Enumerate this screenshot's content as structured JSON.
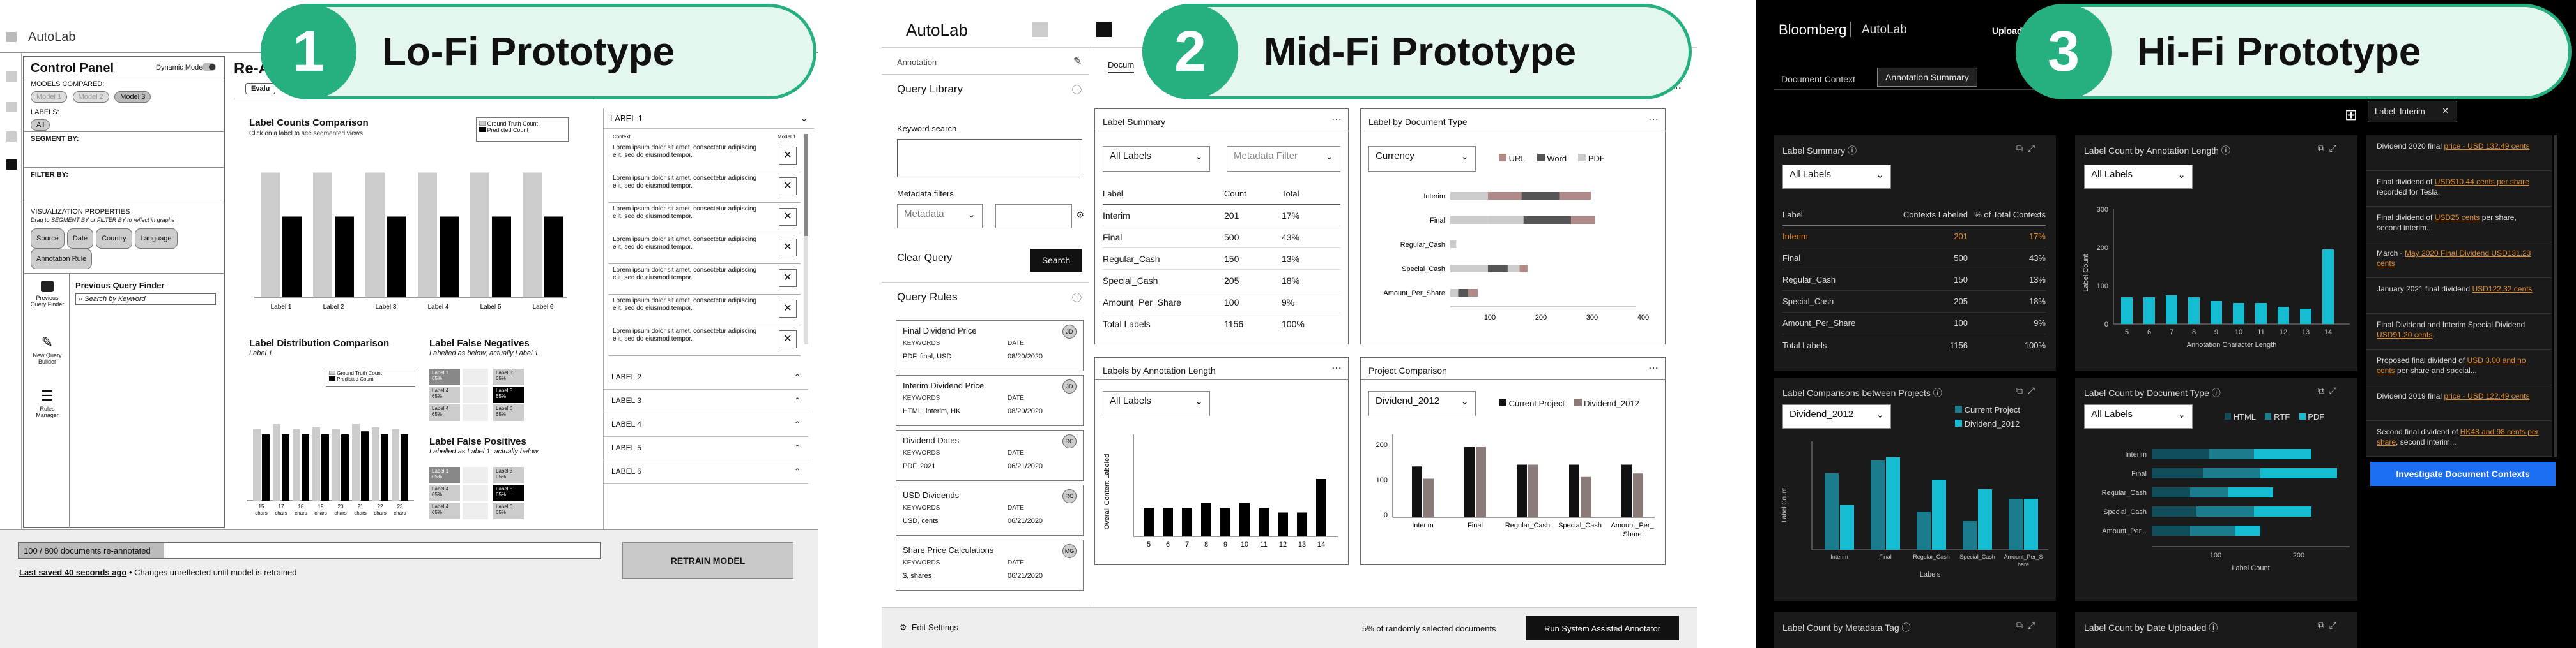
{
  "badges": [
    {
      "num": "1",
      "title": "Lo-Fi Prototype"
    },
    {
      "num": "2",
      "title": "Mid-Fi Prototype"
    },
    {
      "num": "3",
      "title": "Hi-Fi Prototype"
    }
  ],
  "lofi": {
    "app_title": "AutoLab",
    "control_panel": "Control Panel",
    "dynamic_mode": "Dynamic Mode",
    "models_compared": "MODELS COMPARED:",
    "model_chips": [
      "Model 1",
      "Model 2",
      "Model 3"
    ],
    "labels": "LABELS:",
    "all_chip": "All",
    "segment_by": "SEGMENT BY:",
    "filter_by": "FILTER BY:",
    "vis_props": "VISUALIZATION PROPERTIES",
    "vis_hint": "Drag to SEGMENT BY or FILTER BY to reflect in graphs",
    "vis_chips": [
      "Source",
      "Date",
      "Country",
      "Language",
      "Annotation Rule"
    ],
    "prev_query_finder": "Previous Query Finder",
    "search_placeholder": "Search by Keyword",
    "nav_prev": "Previous Query Finder",
    "nav_new": "New Query Builder",
    "nav_rules": "Rules Manager",
    "heading_partial": "Re-A",
    "tab_partial": "Evalu",
    "label_counts_title": "Label Counts Comparison",
    "label_counts_sub": "Click on a label to see segmented views",
    "legend_gt": "Ground Truth Count",
    "legend_pred": "Predicted Count",
    "label_counts_x": [
      "Label 1",
      "Label 2",
      "Label 3",
      "Label 4",
      "Label 5",
      "Label 6"
    ],
    "label_counts_gt": [
      0.85,
      0.85,
      0.85,
      0.85,
      0.85,
      0.85
    ],
    "label_counts_pred": [
      0.55,
      0.55,
      0.55,
      0.55,
      0.55,
      0.55
    ],
    "label_dist_title": "Label Distribution Comparison",
    "label_dist_sub": "Label 1",
    "label_dist_x": [
      "15 chars",
      "17 chars",
      "18 chars",
      "19 chars",
      "20 chars",
      "21 chars",
      "22 chars",
      "23 chars"
    ],
    "false_neg_title": "Label False Negatives",
    "false_neg_sub": "Labelled as below; actually Label 1",
    "false_pos_title": "Label False Positives",
    "false_pos_sub": "Labelled as Label 1; actually below",
    "fn_cells": [
      {
        "l": "Label 1",
        "p": "65%"
      },
      {
        "l": "Label 3",
        "p": "65%"
      },
      {
        "l": "Label 4",
        "p": "65%"
      },
      {
        "l": "Label 5",
        "p": "65%"
      },
      {
        "l": "Label 4",
        "p": "65%"
      },
      {
        "l": "Label 6",
        "p": "65%"
      }
    ],
    "fp_cells": [
      {
        "l": "Label 1",
        "p": "65%"
      },
      {
        "l": "Label 3",
        "p": "65%"
      },
      {
        "l": "Label 4",
        "p": "65%"
      },
      {
        "l": "Label 5",
        "p": "65%"
      },
      {
        "l": "Label 4",
        "p": "65%"
      },
      {
        "l": "Label 6",
        "p": "65%"
      }
    ],
    "acc_open": "LABEL 1",
    "col_context": "Context",
    "col_model": "Model 1",
    "lorem": "Lorem ipsum dolor sit amet, consectetur adipiscing elit, sed do eiusmod tempor.",
    "acc_rows": [
      "LABEL 2",
      "LABEL 3",
      "LABEL 4",
      "LABEL 5",
      "LABEL 6"
    ],
    "progress": "100 / 800 documents re-annotated",
    "last_saved": "Last saved 40 seconds ago",
    "changes_note": "• Changes unreflected until model is retrained",
    "retrain": "RETRAIN MODEL"
  },
  "midfi": {
    "app_title": "AutoLab",
    "annotation": "Annotation",
    "tab_partial": "Docum",
    "query_library": "Query Library",
    "keyword_search": "Keyword search",
    "metadata_filters": "Metadata filters",
    "metadata_select": "Metadata",
    "clear_query": "Clear Query",
    "search": "Search",
    "query_rules": "Query Rules",
    "kw": "KEYWORDS",
    "date": "DATE",
    "rules": [
      {
        "name": "Final Dividend Price",
        "kw": "PDF, final, USD",
        "date": "08/20/2020",
        "av": "JD"
      },
      {
        "name": "Interim Dividend Price",
        "kw": "HTML, interim, HK",
        "date": "08/20/2020",
        "av": "JD"
      },
      {
        "name": "Dividend Dates",
        "kw": "PDF, 2021",
        "date": "06/21/2020",
        "av": "RC"
      },
      {
        "name": "USD Dividends",
        "kw": "USD, cents",
        "date": "06/21/2020",
        "av": "RC"
      },
      {
        "name": "Share Price Calculations",
        "kw": "$, shares",
        "date": "06/21/2020",
        "av": "MG"
      }
    ],
    "edit_settings": "Edit Settings",
    "pct_note": "5% of randomly selected documents",
    "run_btn": "Run System Assisted Annotator",
    "label_summary": {
      "title": "Label Summary",
      "filter": "All Labels",
      "meta": "Metadata Filter",
      "cols": [
        "Label",
        "Count",
        "Total"
      ],
      "rows": [
        [
          "Interim",
          "201",
          "17%"
        ],
        [
          "Final",
          "500",
          "43%"
        ],
        [
          "Regular_Cash",
          "150",
          "13%"
        ],
        [
          "Special_Cash",
          "205",
          "18%"
        ],
        [
          "Amount_Per_Share",
          "100",
          "9%"
        ]
      ],
      "total": [
        "Total Labels",
        "1156",
        "100%"
      ]
    },
    "by_doc_type": {
      "title": "Label by Document Type",
      "filter": "Currency",
      "legend": [
        "URL",
        "Word",
        "PDF"
      ],
      "cats": [
        "Interim",
        "Final",
        "Regular_Cash",
        "Special_Cash",
        "Amount_Per_Share"
      ],
      "ticks": [
        "100",
        "200",
        "300",
        "400"
      ],
      "segs": [
        [
          95,
          0,
          165,
          0,
          250,
          10
        ],
        [
          95,
          0,
          100,
          0,
          265,
          5
        ],
        [
          15,
          0,
          0,
          0,
          0,
          0
        ],
        [
          120,
          60,
          0,
          0,
          0,
          0
        ],
        [
          0,
          0,
          70,
          0,
          0,
          0
        ]
      ]
    },
    "by_length": {
      "title": "Labels by Annotation Length",
      "filter": "All Labels",
      "ylabel": "Overall Content Labeled",
      "x": [
        "5",
        "6",
        "7",
        "8",
        "9",
        "10",
        "11",
        "12",
        "13",
        "14"
      ],
      "v": [
        0.3,
        0.3,
        0.3,
        0.35,
        0.3,
        0.35,
        0.3,
        0.25,
        0.25,
        0.6
      ]
    },
    "project_cmp": {
      "title": "Project Comparison",
      "filter": "Dividend_2012",
      "legend": [
        "Current Project",
        "Dividend_2012"
      ],
      "cats": [
        "Interim",
        "Final",
        "Regular_Cash",
        "Special_Cash",
        "Amount_Per_Share"
      ],
      "yticks": [
        "200",
        "100",
        "0"
      ],
      "cur": [
        145,
        200,
        150,
        150,
        150
      ],
      "old": [
        110,
        200,
        150,
        115,
        125
      ]
    }
  },
  "hifi": {
    "brand": "Bloomberg",
    "app": "AutoLab",
    "upload": "Upload",
    "tabs": [
      "Document Context",
      "Annotation Summary"
    ],
    "label_chip": "Label: Interim",
    "invest_btn": "Investigate Document Contexts",
    "summary": {
      "title": "Label Summary",
      "filter": "All Labels",
      "cols": [
        "Label",
        "Contexts Labeled",
        "% of Total Contexts"
      ],
      "rows": [
        [
          "Interim",
          "201",
          "17%"
        ],
        [
          "Final",
          "500",
          "43%"
        ],
        [
          "Regular_Cash",
          "150",
          "13%"
        ],
        [
          "Special_Cash",
          "205",
          "18%"
        ],
        [
          "Amount_Per_Share",
          "100",
          "9%"
        ]
      ],
      "total": [
        "Total Labels",
        "1156",
        "100%"
      ]
    },
    "by_length": {
      "title": "Label Count by Annotation Length",
      "filter": "All Labels",
      "ylabel": "Label Count",
      "xlabel": "Annotation Character Length",
      "x": [
        "5",
        "6",
        "7",
        "8",
        "9",
        "10",
        "11",
        "12",
        "13",
        "14"
      ],
      "yticks": [
        "300",
        "200",
        "100",
        "0"
      ],
      "v": [
        70,
        70,
        75,
        70,
        60,
        55,
        55,
        45,
        40,
        195
      ]
    },
    "between": {
      "title": "Label Comparisons between Projects",
      "filter": "Dividend_2012",
      "legend": [
        "Current Project",
        "Dividend_2012"
      ],
      "ylabel": "Label Count",
      "xlabel": "Labels",
      "cats": [
        "Interim",
        "Final",
        "Regular_Cash",
        "Special_Cash",
        "Amount_Per_Share"
      ]
    },
    "by_doc": {
      "title": "Label Count by Document Type",
      "filter": "All Labels",
      "legend": [
        "HTML",
        "RTF",
        "PDF"
      ],
      "xlabel": "Label Count",
      "cats": [
        "Interim",
        "Final",
        "Regular_Cash",
        "Special_Cash",
        "Amount_Per..."
      ],
      "ticks": [
        "100",
        "200"
      ]
    },
    "by_meta": {
      "title": "Label Count by Metadata Tag"
    },
    "by_date": {
      "title": "Label Count by Date Uploaded"
    },
    "contexts": [
      [
        "Dividend 2020 final ",
        "price - USD 132.49 cents"
      ],
      [
        "Final dividend of ",
        "USD$10.44 cents per share",
        " recorded for Tesla."
      ],
      [
        "Final dividend of ",
        "USD25 cents",
        " per share, second interim..."
      ],
      [
        "March - ",
        "May 2020 Final Dividend USD131.23 cents"
      ],
      [
        "January 2021 final dividend ",
        "USD122.32 cents"
      ],
      [
        "Final Dividend and Interim Special Dividend ",
        "USD91.20 cents",
        "."
      ],
      [
        "Proposed final dividend of ",
        "USD 3.00 and no cents",
        " per share and special..."
      ],
      [
        "Dividend 2019 final ",
        "price - USD 122.49 cents"
      ],
      [
        "Second final dividend of ",
        "HK48 and 98 cents per share",
        ", second interim..."
      ]
    ]
  },
  "colors": {
    "green": "#27b07f",
    "teal": "#14bcd1",
    "orange": "#e08a2b",
    "blue": "#1c6ef2",
    "taupe": "#9b8a88"
  }
}
